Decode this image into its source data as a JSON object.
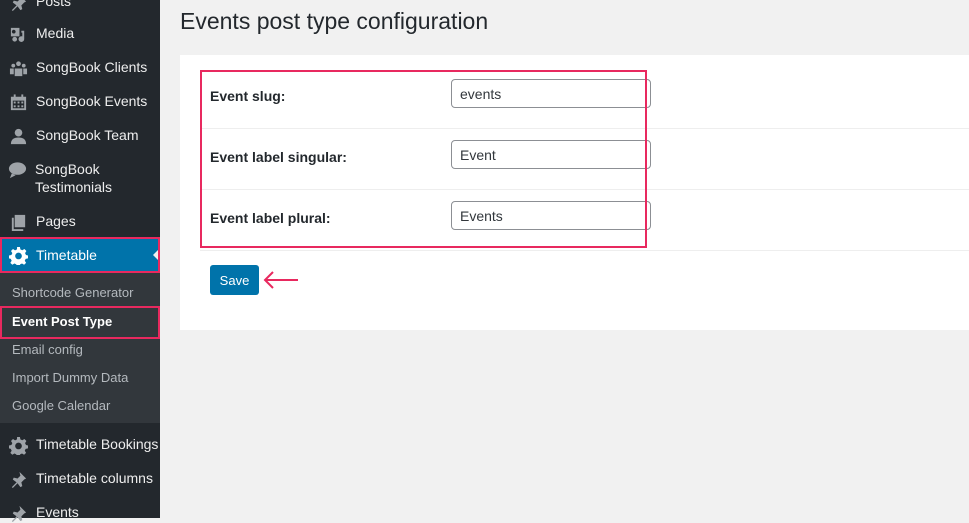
{
  "sidebar": {
    "items": [
      {
        "label": "Posts",
        "icon": "pin-icon"
      },
      {
        "label": "Media",
        "icon": "media-icon"
      },
      {
        "label": "SongBook Clients",
        "icon": "groups-icon"
      },
      {
        "label": "SongBook Events",
        "icon": "calendar-icon"
      },
      {
        "label": "SongBook Team",
        "icon": "user-icon"
      },
      {
        "label": "SongBook Testimonials",
        "icon": "testimonial-icon"
      },
      {
        "label": "Pages",
        "icon": "pages-icon"
      },
      {
        "label": "Timetable",
        "icon": "gear-icon"
      },
      {
        "label": "Timetable Bookings",
        "icon": "gear-icon"
      },
      {
        "label": "Timetable columns",
        "icon": "pin-icon"
      },
      {
        "label": "Events",
        "icon": "pin-icon"
      }
    ],
    "submenu": [
      {
        "label": "Shortcode Generator"
      },
      {
        "label": "Event Post Type"
      },
      {
        "label": "Email config"
      },
      {
        "label": "Import Dummy Data"
      },
      {
        "label": "Google Calendar"
      }
    ]
  },
  "main": {
    "title": "Events post type configuration",
    "fields": [
      {
        "label": "Event slug:",
        "value": "events"
      },
      {
        "label": "Event label singular:",
        "value": "Event"
      },
      {
        "label": "Event label plural:",
        "value": "Events"
      }
    ],
    "save_label": "Save"
  },
  "colors": {
    "accent": "#0073aa",
    "highlight": "#e8295f",
    "sidebar_bg": "#23282d"
  }
}
